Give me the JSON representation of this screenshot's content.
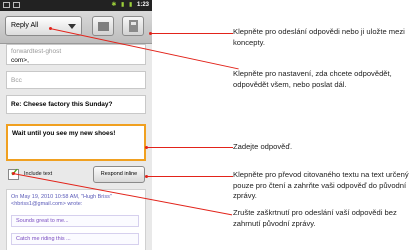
{
  "status_bar": {
    "time": "1:23"
  },
  "toolbar": {
    "reply_mode": "Reply All"
  },
  "compose": {
    "to_value_1": "forwardtest-ghost",
    "to_value_2": "com>,",
    "bcc_placeholder": "Bcc",
    "subject": "Re: Cheese factory this Sunday?",
    "body": "Wait until you see my new shoes!",
    "include_text_label": "Include text",
    "respond_inline_label": "Respond inline"
  },
  "quoted": {
    "header": "On May 19, 2010 10:58 AM, \"Hugh Briss\" <hbriss1@gmail.com> wrote:",
    "line1": "Sounds great to me...",
    "line2": "Catch me riding this ..."
  },
  "callouts": [
    "Klepněte pro odeslání odpovědi nebo ji uložte mezi koncepty.",
    "Klepněte pro nastavení, zda chcete odpovědět, odpovědět všem, nebo poslat dál.",
    "Zadejte odpověď.",
    "Klepněte pro převod citovaného textu na text určený pouze pro čtení a zahrňte vaši odpověď do původní zprávy.",
    "Zrušte zaškrtnutí pro odeslání vaší odpovědi bez zahrnutí původní zprávy."
  ],
  "colors": {
    "callout_line": "#e2231a",
    "focus_border": "#f0a020",
    "checkmark": "#4aa91f"
  }
}
